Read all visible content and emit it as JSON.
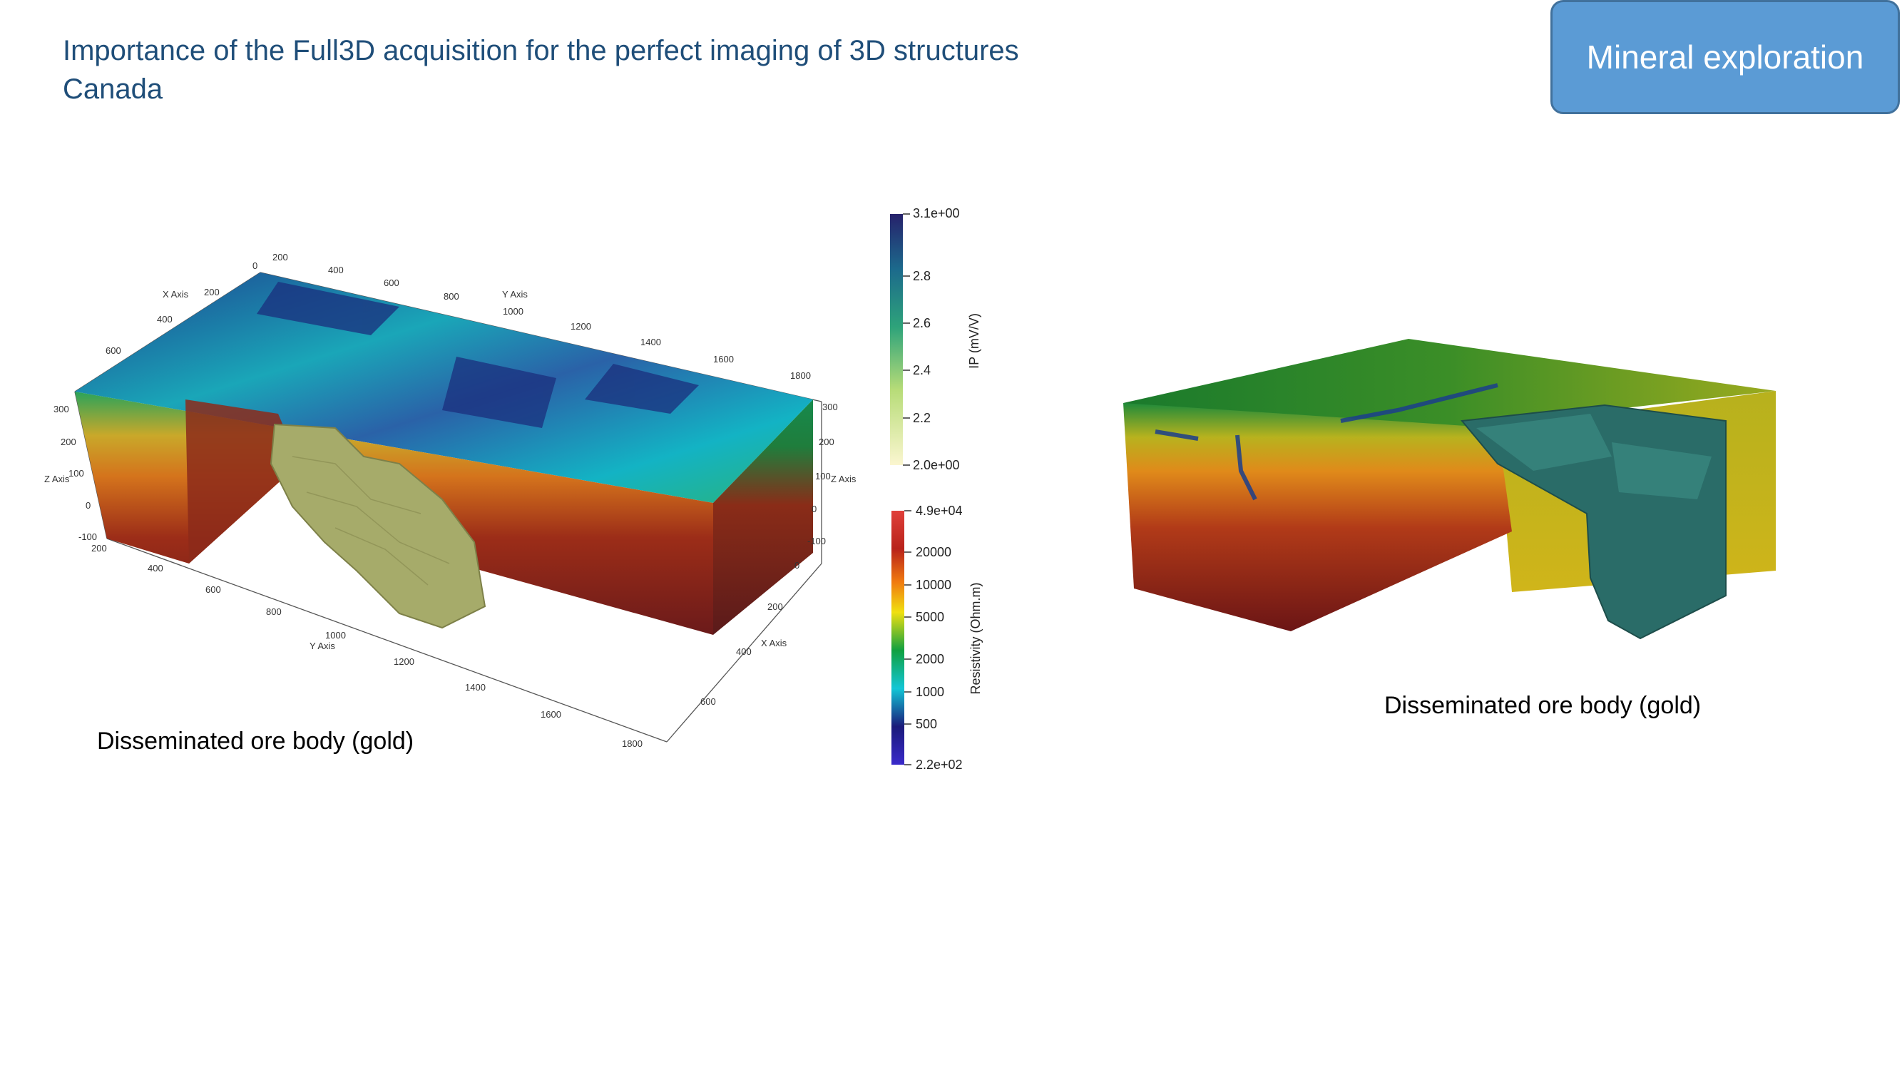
{
  "header": {
    "title_line1": "Importance of the Full3D acquisition for the perfect imaging of 3D structures",
    "title_line2": "Canada",
    "badge": "Mineral exploration"
  },
  "captions": {
    "left": "Disseminated ore body (gold)",
    "right": "Disseminated ore body (gold)"
  },
  "left_model": {
    "x_axis_title": "X Axis",
    "y_axis_title": "Y Axis",
    "z_axis_title": "Z Axis",
    "x_ticks_top": [
      "200",
      "400",
      "600"
    ],
    "y_ticks_top": [
      "0",
      "200",
      "400",
      "600",
      "800",
      "1000",
      "1200",
      "1400",
      "1600",
      "1800"
    ],
    "z_ticks_left": [
      "300",
      "200",
      "100",
      "0",
      "-100"
    ],
    "z_ticks_right": [
      "300",
      "200",
      "100",
      "0",
      "-100"
    ],
    "x_ticks_bottom_right": [
      "0",
      "200",
      "400",
      "600"
    ],
    "y_ticks_bottom": [
      "200",
      "400",
      "600",
      "800",
      "1000",
      "1200",
      "1400",
      "1600",
      "1800"
    ]
  },
  "colorbar_ip": {
    "label": "IP (mV/V)",
    "max": "3.1e+00",
    "min": "2.0e+00",
    "ticks": [
      "2.8",
      "2.6",
      "2.4",
      "2.2"
    ]
  },
  "colorbar_res": {
    "label": "Resistivity (Ohm.m)",
    "max": "4.9e+04",
    "min": "2.2e+02",
    "ticks": [
      "20000",
      "10000",
      "5000",
      "2000",
      "1000",
      "500"
    ]
  },
  "colors": {
    "title": "#1f4e79",
    "badge_fill": "#5b9bd5",
    "ore_body": "#a6ab6a"
  }
}
